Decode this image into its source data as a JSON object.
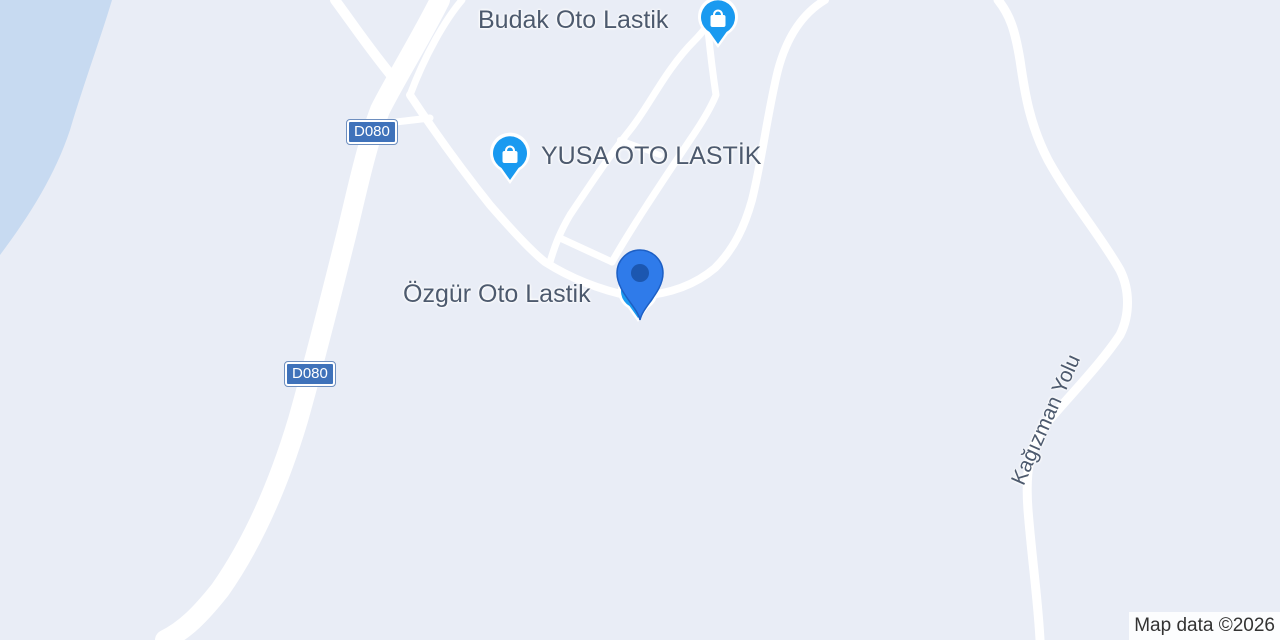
{
  "map": {
    "colors": {
      "land": "#e9edf6",
      "water": "#c7daf1",
      "road": "#ffffff",
      "shield_bg": "#3f72ba",
      "poi_blue": "#1a9af0",
      "marker_blue": "#2f7bea",
      "label": "#4d5a6e"
    },
    "route_shields": [
      {
        "text": "D080"
      },
      {
        "text": "D080"
      }
    ],
    "pois": [
      {
        "name": "Budak Oto Lastik",
        "icon": "shopping-bag-icon"
      },
      {
        "name": "YUSA OTO LASTİK",
        "icon": "shopping-bag-icon"
      },
      {
        "name": "Özgür Oto Lastik",
        "icon": "shopping-bag-icon"
      }
    ],
    "road_labels": [
      {
        "text": "Kağızman Yolu"
      }
    ],
    "attribution": "Map data ©2026",
    "marker": {
      "icon": "location-pin-icon"
    }
  }
}
